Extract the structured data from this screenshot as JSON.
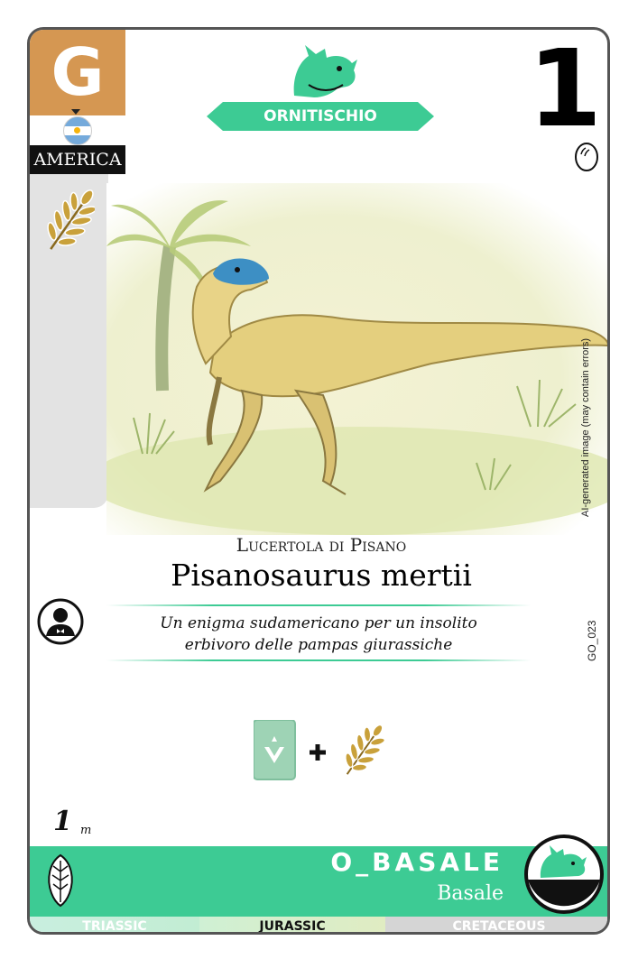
{
  "card": {
    "series_letter": "G",
    "region": "AMERICA",
    "flag_icon": "argentina-flag-icon",
    "diet_icon": "leaf-icon",
    "clade": "ORNITISCHIO",
    "clade_icon": "triceratops-head-icon",
    "card_number": "1",
    "egg_icon": "egg-icon",
    "ai_note": "AI-generated image (may contain errors)",
    "code": "GO_023",
    "common_name": "Lucertola di Pisano",
    "scientific_name": "Pisanosaurus mertii",
    "description_line1": "Un enigma sudamericano per un insolito",
    "description_line2": "erbivoro delle pampas giurassiche",
    "avatar_icon": "person-silhouette-icon",
    "length_value": "1",
    "length_unit": "m",
    "group_code": "O_BASALE",
    "group_name": "Basale",
    "periods": [
      "TRIASSIC",
      "JURASSIC",
      "CRETACEOUS"
    ],
    "active_period": "JURASSIC"
  },
  "colors": {
    "accent_green": "#3dcb94",
    "series_orange": "#d59752",
    "side_gray": "#e3e3e3",
    "leaf_gold": "#c9a13b"
  }
}
